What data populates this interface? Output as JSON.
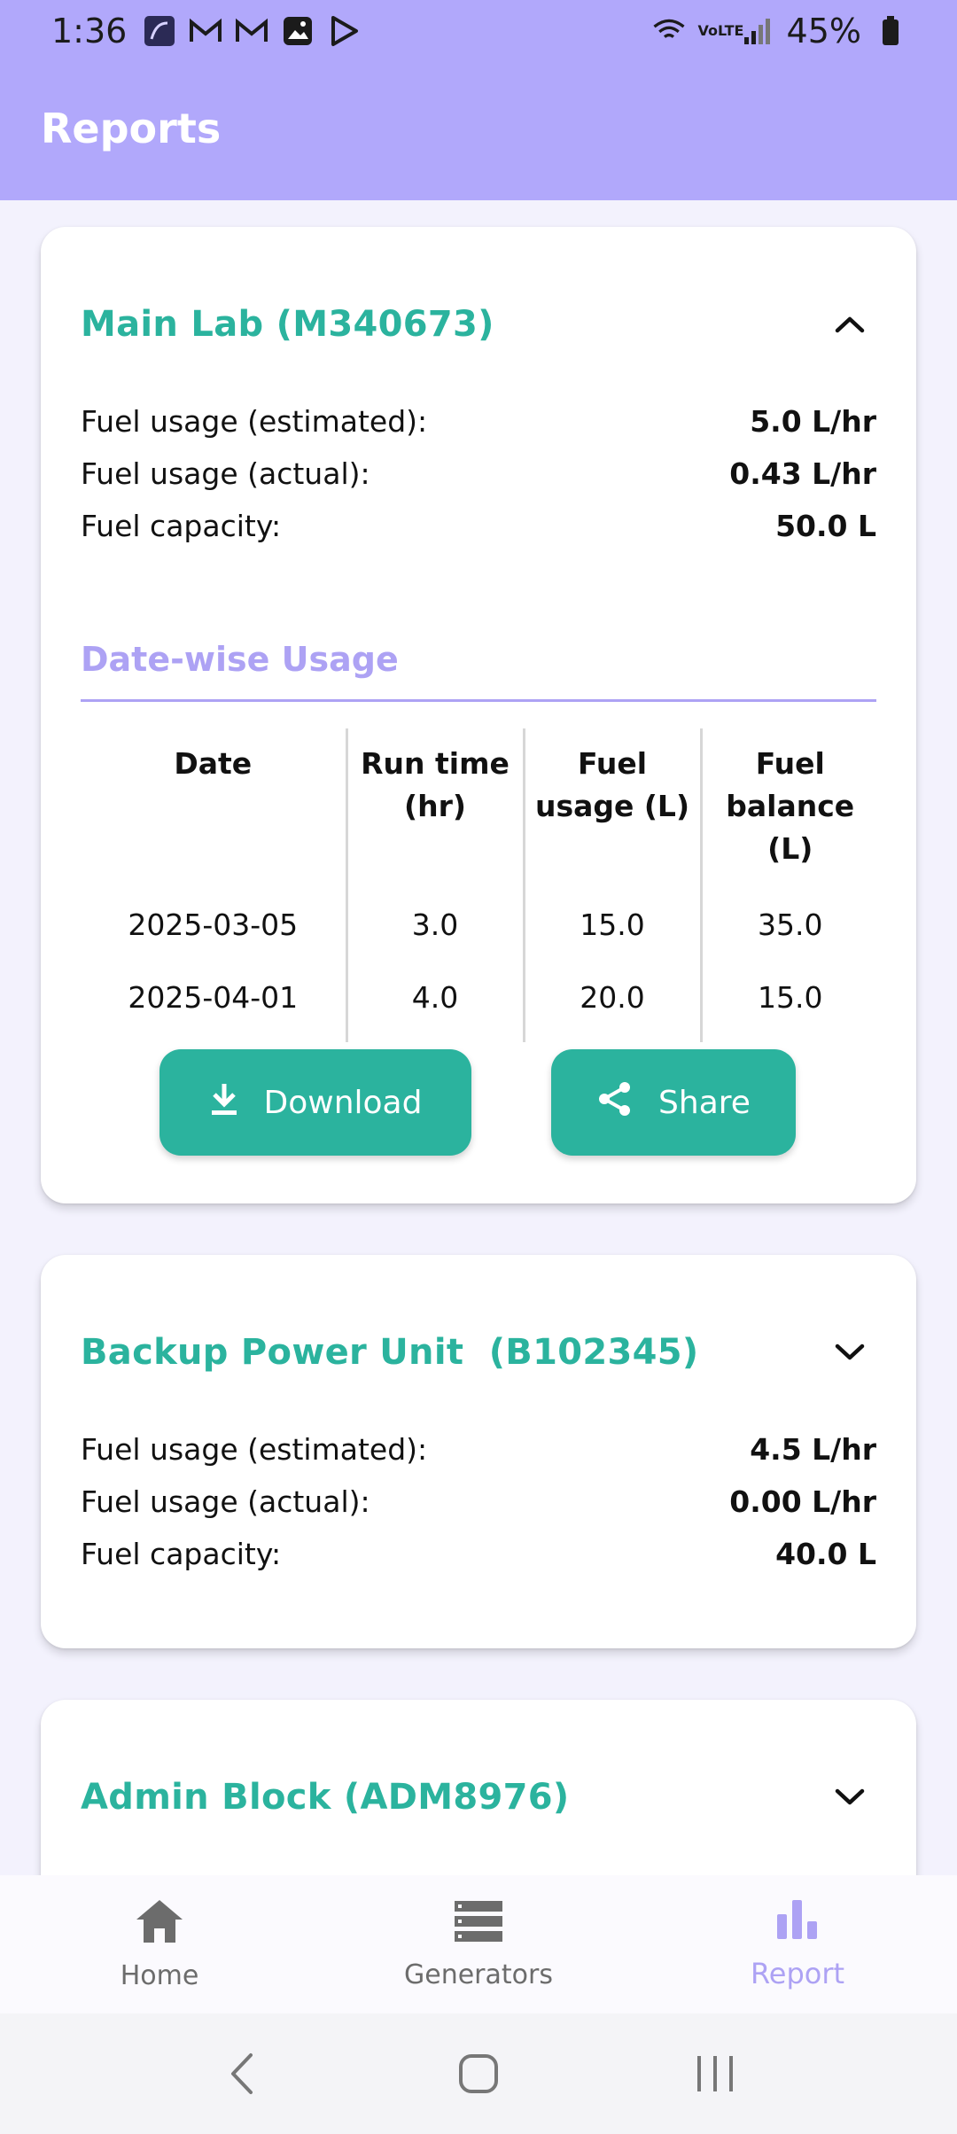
{
  "status_bar": {
    "time": "1:36",
    "battery": "45%",
    "network": "VoLTE"
  },
  "app_bar": {
    "title": "Reports"
  },
  "cards": [
    {
      "title": "Main Lab (M340673)",
      "expanded": true,
      "metrics": [
        {
          "label": "Fuel usage (estimated):",
          "value": "5.0 L/hr"
        },
        {
          "label": "Fuel usage (actual):",
          "value": "0.43 L/hr"
        },
        {
          "label": "Fuel capacity:",
          "value": "50.0 L"
        }
      ],
      "section_title": "Date-wise Usage",
      "table": {
        "headers": [
          "Date",
          "Run time (hr)",
          "Fuel usage (L)",
          "Fuel balance (L)"
        ],
        "rows": [
          [
            "2025-03-05",
            "3.0",
            "15.0",
            "35.0"
          ],
          [
            "2025-04-01",
            "4.0",
            "20.0",
            "15.0"
          ]
        ]
      },
      "download_label": "Download",
      "share_label": "Share"
    },
    {
      "title": "Backup Power Unit  (B102345)",
      "expanded": false,
      "metrics": [
        {
          "label": "Fuel usage (estimated):",
          "value": "4.5 L/hr"
        },
        {
          "label": "Fuel usage (actual):",
          "value": "0.00 L/hr"
        },
        {
          "label": "Fuel capacity:",
          "value": "40.0 L"
        }
      ]
    },
    {
      "title": "Admin Block (ADM8976)",
      "expanded": false
    }
  ],
  "bottom_nav": [
    {
      "label": "Home",
      "icon": "home-icon"
    },
    {
      "label": "Generators",
      "icon": "list-icon"
    },
    {
      "label": "Report",
      "icon": "bar-chart-icon",
      "active": true
    }
  ],
  "colors": {
    "app_bar": "#b1a8fb",
    "accent_teal": "#2bb39e",
    "accent_lavender": "#ada2f4",
    "background": "#f3f2fd"
  }
}
